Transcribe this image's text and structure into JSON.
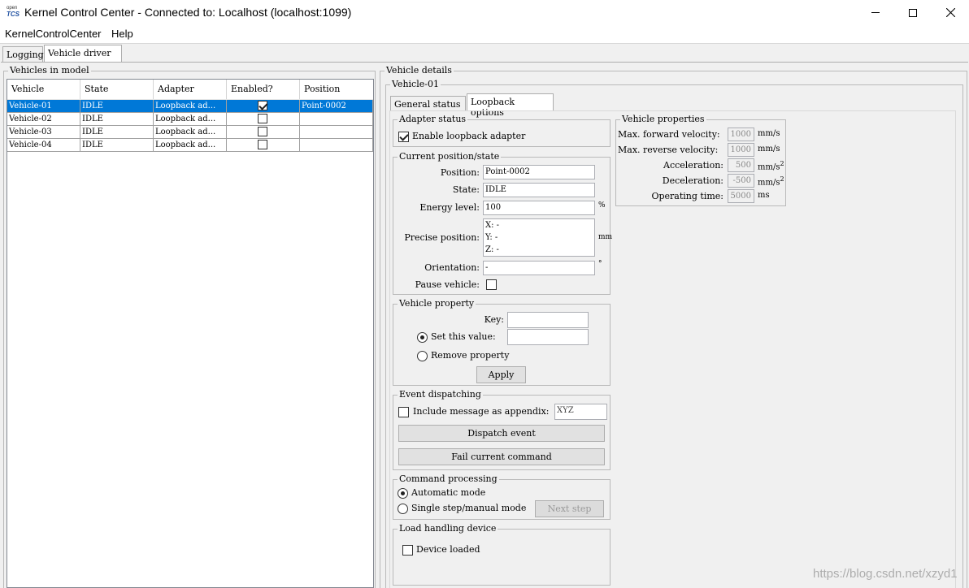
{
  "window": {
    "logo_top": "open",
    "logo_bottom": "TCS",
    "title": "Kernel Control Center - Connected to: Localhost (localhost:1099)"
  },
  "menu": [
    "KernelControlCenter",
    "Help"
  ],
  "tabs": [
    "Logging",
    "Vehicle driver"
  ],
  "vehicles_panel": {
    "title": "Vehicles in model",
    "columns": [
      "Vehicle",
      "State",
      "Adapter",
      "Enabled?",
      "Position"
    ],
    "rows": [
      {
        "vehicle": "Vehicle-01",
        "state": "IDLE",
        "adapter": "Loopback ad...",
        "enabled": true,
        "position": "Point-0002"
      },
      {
        "vehicle": "Vehicle-02",
        "state": "IDLE",
        "adapter": "Loopback ad...",
        "enabled": false,
        "position": ""
      },
      {
        "vehicle": "Vehicle-03",
        "state": "IDLE",
        "adapter": "Loopback ad...",
        "enabled": false,
        "position": ""
      },
      {
        "vehicle": "Vehicle-04",
        "state": "IDLE",
        "adapter": "Loopback ad...",
        "enabled": false,
        "position": ""
      }
    ]
  },
  "details": {
    "title": "Vehicle details",
    "vehicle_name": "Vehicle-01",
    "subtabs": [
      "General status",
      "Loopback options"
    ],
    "adapter_status": {
      "title": "Adapter status",
      "enable_label": "Enable loopback adapter",
      "enabled": true
    },
    "current": {
      "title": "Current position/state",
      "position_label": "Position:",
      "position_value": "Point-0002",
      "state_label": "State:",
      "state_value": "IDLE",
      "energy_label": "Energy level:",
      "energy_value": "100",
      "energy_unit": "%",
      "precise_label": "Precise position:",
      "precise_x": "X: -",
      "precise_y": "Y: -",
      "precise_z": "Z: -",
      "precise_unit": "mm",
      "orientation_label": "Orientation:",
      "orientation_value": "-",
      "orientation_unit": "°",
      "pause_label": "Pause vehicle:",
      "pause_checked": false
    },
    "vehicle_property": {
      "title": "Vehicle property",
      "key_label": "Key:",
      "key_value": "",
      "set_label": "Set this value:",
      "set_value": "",
      "remove_label": "Remove property",
      "apply_label": "Apply"
    },
    "event_dispatching": {
      "title": "Event dispatching",
      "include_label": "Include message as appendix:",
      "include_checked": false,
      "appendix_value": "XYZ",
      "dispatch_label": "Dispatch event",
      "fail_label": "Fail current command"
    },
    "command_processing": {
      "title": "Command processing",
      "automatic_label": "Automatic mode",
      "single_label": "Single step/manual mode",
      "next_label": "Next step"
    },
    "load_handling": {
      "title": "Load handling device",
      "loaded_label": "Device loaded",
      "loaded_checked": false
    },
    "vehicle_properties": {
      "title": "Vehicle properties",
      "max_fwd_label": "Max. forward velocity:",
      "max_fwd_value": "1000",
      "max_fwd_unit": "mm/s",
      "max_rev_label": "Max. reverse velocity:",
      "max_rev_value": "1000",
      "max_rev_unit": "mm/s",
      "accel_label": "Acceleration:",
      "accel_value": "500",
      "accel_unit": "mm/s",
      "decel_label": "Deceleration:",
      "decel_value": "-500",
      "decel_unit": "mm/s",
      "sup": "2",
      "op_time_label": "Operating time:",
      "op_time_value": "5000",
      "op_time_unit": "ms"
    }
  },
  "watermark": "https://blog.csdn.net/xzyd1",
  "colors": {
    "selection": "#0078d7",
    "selection_text": "#ffffff"
  }
}
